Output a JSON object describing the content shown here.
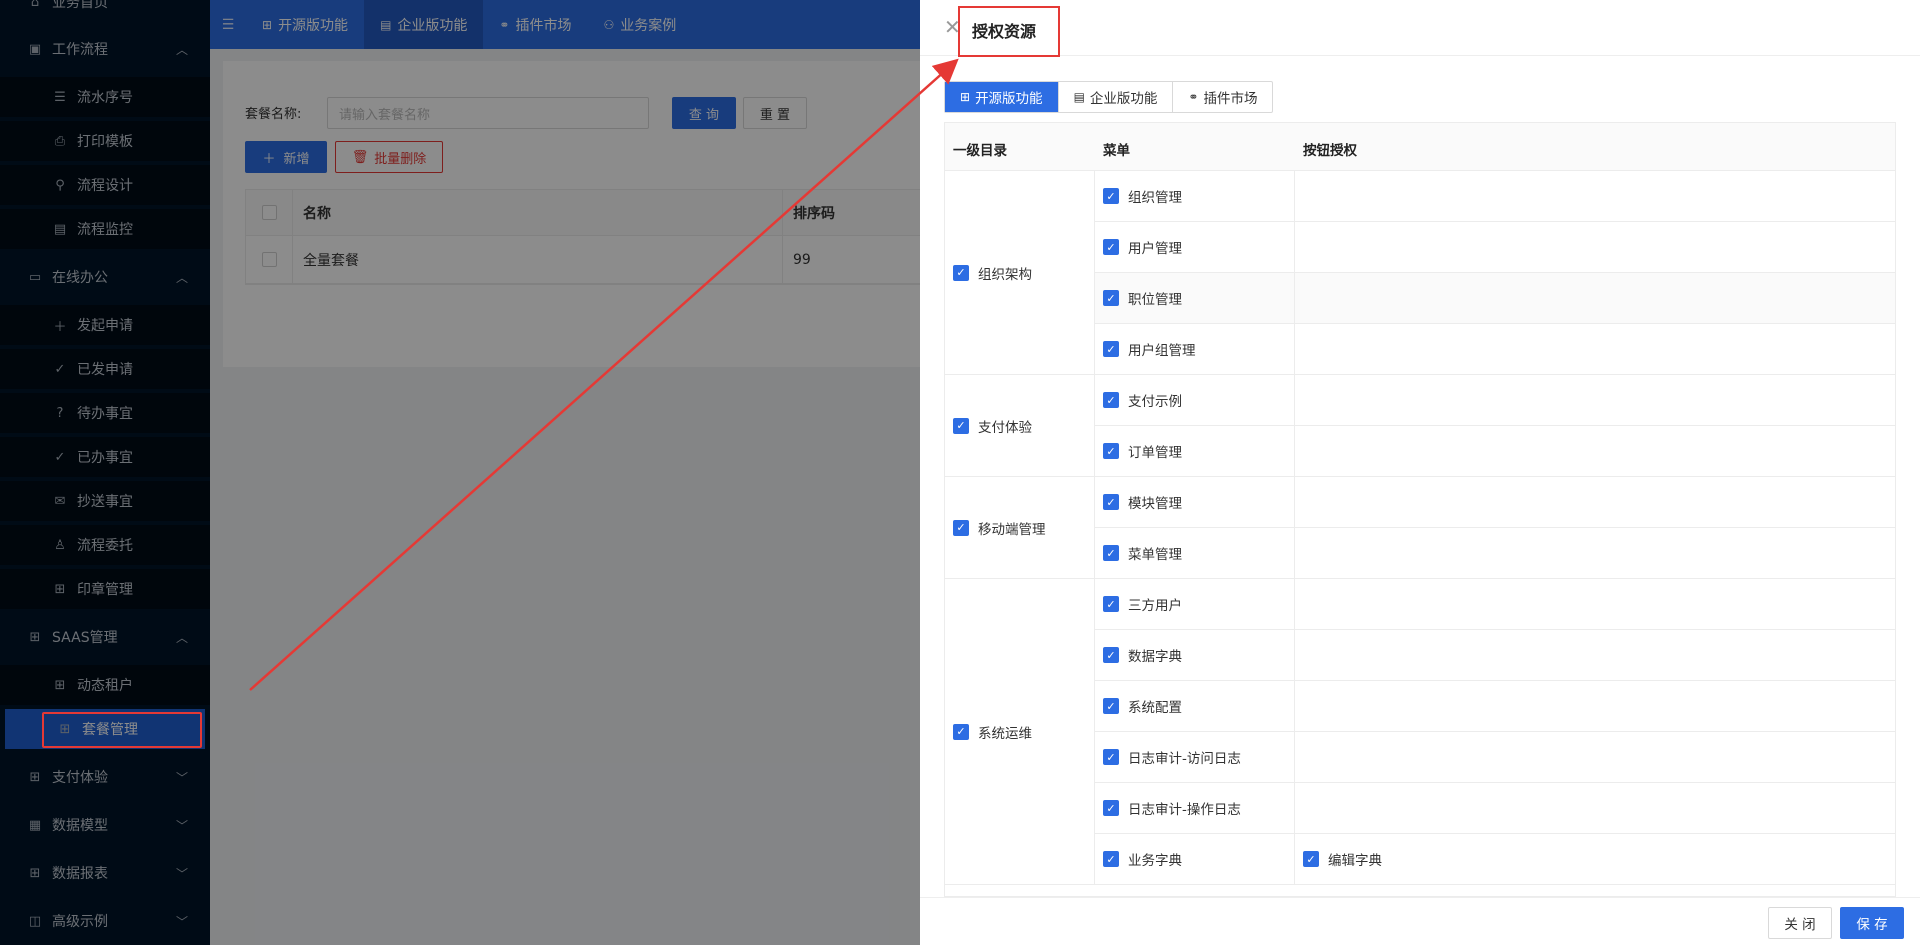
{
  "sidebar": {
    "items": [
      {
        "label": "业务首页",
        "icon": "home-icon",
        "level": "top"
      },
      {
        "label": "工作流程",
        "icon": "workflow-icon",
        "level": "top",
        "chevron": "up"
      },
      {
        "label": "流水序号",
        "icon": "list-number-icon",
        "level": "sub"
      },
      {
        "label": "打印模板",
        "icon": "printer-icon",
        "level": "sub"
      },
      {
        "label": "流程设计",
        "icon": "flow-design-icon",
        "level": "sub"
      },
      {
        "label": "流程监控",
        "icon": "monitor-icon",
        "level": "sub"
      },
      {
        "label": "在线办公",
        "icon": "laptop-icon",
        "level": "top",
        "chevron": "up"
      },
      {
        "label": "发起申请",
        "icon": "plus-icon",
        "level": "sub"
      },
      {
        "label": "已发申请",
        "icon": "check-icon",
        "level": "sub"
      },
      {
        "label": "待办事宜",
        "icon": "question-circle-icon",
        "level": "sub"
      },
      {
        "label": "已办事宜",
        "icon": "check-circle-icon",
        "level": "sub"
      },
      {
        "label": "抄送事宜",
        "icon": "mail-icon",
        "level": "sub"
      },
      {
        "label": "流程委托",
        "icon": "user-icon",
        "level": "sub"
      },
      {
        "label": "印章管理",
        "icon": "grid-icon",
        "level": "sub"
      },
      {
        "label": "SAAS管理",
        "icon": "grid-icon",
        "level": "top",
        "chevron": "up"
      },
      {
        "label": "动态租户",
        "icon": "grid-icon",
        "level": "sub"
      },
      {
        "label": "套餐管理",
        "icon": "grid-icon",
        "level": "sub",
        "active": true
      },
      {
        "label": "支付体验",
        "icon": "grid-icon",
        "level": "top",
        "chevron": "down"
      },
      {
        "label": "数据模型",
        "icon": "table-icon",
        "level": "top",
        "chevron": "down"
      },
      {
        "label": "数据报表",
        "icon": "grid-icon",
        "level": "top",
        "chevron": "down"
      },
      {
        "label": "高级示例",
        "icon": "chart-icon",
        "level": "top",
        "chevron": "down"
      }
    ]
  },
  "topbar": {
    "tabs": [
      {
        "label": "开源版功能",
        "active": false
      },
      {
        "label": "企业版功能",
        "active": true
      },
      {
        "label": "插件市场",
        "active": false
      },
      {
        "label": "业务案例",
        "active": false
      }
    ]
  },
  "main": {
    "search_label": "套餐名称:",
    "search_placeholder": "请输入套餐名称",
    "query_label": "查 询",
    "reset_label": "重 置",
    "add_label": "新增",
    "batch_delete_label": "批量删除",
    "table": {
      "headers": {
        "name": "名称",
        "sort": "排序码"
      },
      "rows": [
        {
          "name": "全量套餐",
          "sort": "99"
        }
      ]
    }
  },
  "drawer": {
    "title": "授权资源",
    "tabs": [
      {
        "label": "开源版功能",
        "active": true
      },
      {
        "label": "企业版功能",
        "active": false
      },
      {
        "label": "插件市场",
        "active": false
      }
    ],
    "headers": {
      "level1": "一级目录",
      "menu": "菜单",
      "button": "按钮授权"
    },
    "groups": [
      {
        "label": "组织架构",
        "menus": [
          {
            "label": "组织管理",
            "buttons": []
          },
          {
            "label": "用户管理",
            "buttons": []
          },
          {
            "label": "职位管理",
            "buttons": []
          },
          {
            "label": "用户组管理",
            "buttons": []
          }
        ]
      },
      {
        "label": "支付体验",
        "menus": [
          {
            "label": "支付示例",
            "buttons": []
          },
          {
            "label": "订单管理",
            "buttons": []
          }
        ]
      },
      {
        "label": "移动端管理",
        "menus": [
          {
            "label": "模块管理",
            "buttons": []
          },
          {
            "label": "菜单管理",
            "buttons": []
          }
        ]
      },
      {
        "label": "系统运维",
        "menus": [
          {
            "label": "三方用户",
            "buttons": []
          },
          {
            "label": "数据字典",
            "buttons": []
          },
          {
            "label": "系统配置",
            "buttons": []
          },
          {
            "label": "日志审计-访问日志",
            "buttons": []
          },
          {
            "label": "日志审计-操作日志",
            "buttons": []
          },
          {
            "label": "业务字典",
            "buttons": [
              "编辑字典"
            ]
          }
        ]
      }
    ],
    "footer": {
      "close_label": "关 闭",
      "save_label": "保 存"
    }
  },
  "colors": {
    "primary": "#2d6de3",
    "sidebar_bg": "#001529",
    "annotation_red": "#e53935"
  }
}
